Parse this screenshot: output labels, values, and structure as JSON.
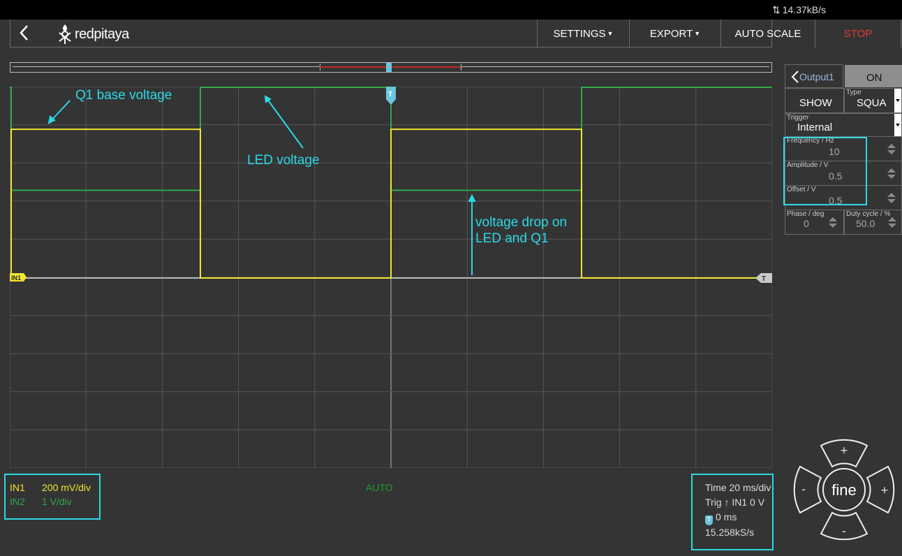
{
  "statusbar": {
    "data_rate": "14.37kB/s"
  },
  "header": {
    "brand": "redpitaya",
    "menu": {
      "settings": "SETTINGS",
      "export": "EXPORT",
      "auto_scale": "AUTO SCALE",
      "stop": "STOP"
    }
  },
  "plot": {
    "annotations": {
      "q1_base": "Q1 base voltage",
      "led_voltage": "LED voltage",
      "drop_line1": "voltage drop on",
      "drop_line2": "LED and Q1"
    },
    "channel_markers": {
      "in1": "IN1",
      "trigger": "T"
    },
    "status": "AUTO"
  },
  "chart_data": {
    "type": "line",
    "grid": true,
    "series": [
      {
        "name": "IN1",
        "color": "#f0e630",
        "waveform": "square",
        "high_div": 3.9,
        "low_div": 0,
        "period_div": 5,
        "duty": 0.5
      },
      {
        "name": "IN2",
        "color": "#2ea84a",
        "waveform": "square",
        "high_div": 5,
        "low_div": 2.3,
        "period_div": 5,
        "duty": 0.5
      }
    ],
    "x_divisions": 10,
    "y_divisions": 10
  },
  "channels": {
    "in1": {
      "label": "IN1",
      "scale": "200 mV/div"
    },
    "in2": {
      "label": "IN2",
      "scale": "1 V/div"
    }
  },
  "timebase": {
    "time": "Time 20 ms/div",
    "trig_prefix": "Trig",
    "trig_source": "IN1 0 V",
    "t_offset": "0 ms",
    "sample_rate": "15.258kS/s"
  },
  "output_panel": {
    "title": "Output1",
    "on_label": "ON",
    "show_label": "SHOW",
    "type_label": "Type",
    "type_value": "SQUA",
    "trigger_label": "Trigger",
    "trigger_value": "Internal",
    "frequency_label": "Frequency / Hz",
    "frequency_value": "10",
    "amplitude_label": "Amplitude / V",
    "amplitude_value": "0.5",
    "offset_label": "Offset / V",
    "offset_value": "0.5",
    "phase_label": "Phase / deg",
    "phase_value": "0",
    "duty_label": "Duty cycle / %",
    "duty_value": "50.0"
  },
  "joystick": {
    "center": "fine",
    "plus": "+",
    "minus": "-"
  },
  "colors": {
    "in1": "#f0e630",
    "in2": "#2ea84a",
    "accent": "#2bd9e6",
    "stop": "#e53935"
  }
}
